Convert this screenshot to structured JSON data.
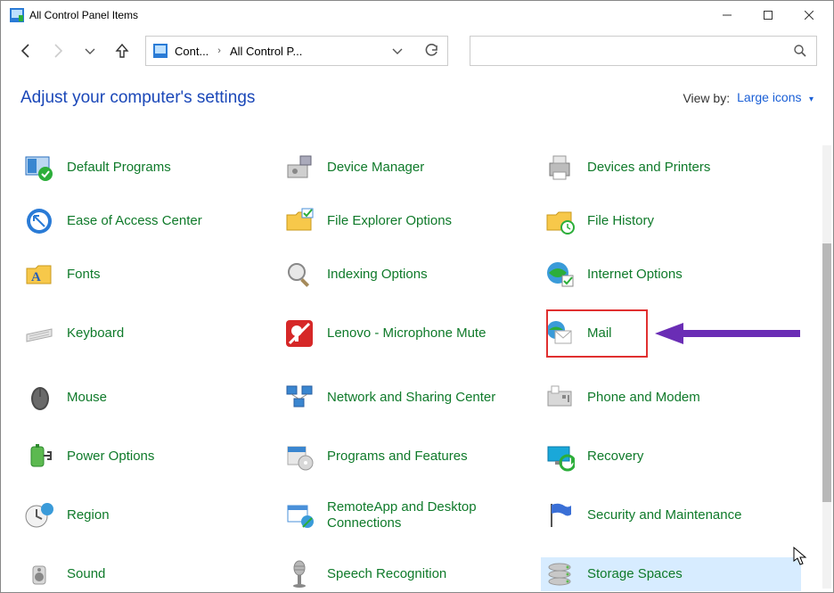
{
  "titlebar": {
    "title": "All Control Panel Items"
  },
  "breadcrumb": {
    "first": "Cont...",
    "second": "All Control P..."
  },
  "header": {
    "adjust": "Adjust your computer's settings",
    "viewby_label": "View by:",
    "viewby_value": "Large icons"
  },
  "items": [
    {
      "id": "default-programs",
      "label": "Default Programs"
    },
    {
      "id": "device-manager",
      "label": "Device Manager"
    },
    {
      "id": "devices-and-printers",
      "label": "Devices and Printers"
    },
    {
      "id": "ease-of-access-center",
      "label": "Ease of Access Center"
    },
    {
      "id": "file-explorer-options",
      "label": "File Explorer Options"
    },
    {
      "id": "file-history",
      "label": "File History"
    },
    {
      "id": "fonts",
      "label": "Fonts"
    },
    {
      "id": "indexing-options",
      "label": "Indexing Options"
    },
    {
      "id": "internet-options",
      "label": "Internet Options"
    },
    {
      "id": "keyboard",
      "label": "Keyboard"
    },
    {
      "id": "lenovo-microphone-mute",
      "label": "Lenovo - Microphone Mute"
    },
    {
      "id": "mail",
      "label": "Mail"
    },
    {
      "id": "mouse",
      "label": "Mouse"
    },
    {
      "id": "network-and-sharing-center",
      "label": "Network and Sharing Center"
    },
    {
      "id": "phone-and-modem",
      "label": "Phone and Modem"
    },
    {
      "id": "power-options",
      "label": "Power Options"
    },
    {
      "id": "programs-and-features",
      "label": "Programs and Features"
    },
    {
      "id": "recovery",
      "label": "Recovery"
    },
    {
      "id": "region",
      "label": "Region"
    },
    {
      "id": "remoteapp-and-desktop-connections",
      "label": "RemoteApp and Desktop Connections"
    },
    {
      "id": "security-and-maintenance",
      "label": "Security and Maintenance"
    },
    {
      "id": "sound",
      "label": "Sound"
    },
    {
      "id": "speech-recognition",
      "label": "Speech Recognition"
    },
    {
      "id": "storage-spaces",
      "label": "Storage Spaces"
    }
  ],
  "tall_rows": [
    "lenovo-microphone-mute",
    "mail",
    "keyboard",
    "network-and-sharing-center",
    "mouse",
    "phone-and-modem",
    "remoteapp-and-desktop-connections",
    "region",
    "security-and-maintenance"
  ],
  "hover_id": "storage-spaces",
  "callout_id": "mail",
  "icons": {
    "default-programs": "programs-check",
    "device-manager": "device-manager",
    "devices-and-printers": "printer",
    "ease-of-access-center": "ease-access",
    "file-explorer-options": "folder-check",
    "file-history": "folder-clock",
    "fonts": "folder-a",
    "indexing-options": "magnifier",
    "internet-options": "globe-check",
    "keyboard": "keyboard",
    "lenovo-microphone-mute": "mic-mute",
    "mail": "mail-globe",
    "mouse": "mouse",
    "network-and-sharing-center": "network",
    "phone-and-modem": "phone-fax",
    "power-options": "battery-plug",
    "programs-and-features": "box-cd",
    "recovery": "monitor-arrow",
    "region": "clock-globe",
    "remoteapp-and-desktop-connections": "window-globe",
    "security-and-maintenance": "flag",
    "sound": "speaker",
    "speech-recognition": "microphone",
    "storage-spaces": "disks"
  }
}
